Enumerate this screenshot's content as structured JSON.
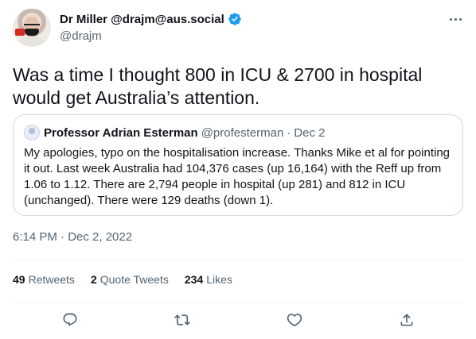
{
  "author": {
    "display_name": "Dr Miller @drajm@aus.social",
    "handle": "@drajm"
  },
  "tweet": {
    "text": "Was a time I thought 800 in ICU & 2700 in hospital would get Australia’s attention."
  },
  "quoted_tweet": {
    "name": "Professor Adrian Esterman",
    "handle": "@profesterman",
    "separator": "·",
    "date": "Dec 2",
    "text": "My apologies, typo on the hospitalisation increase. Thanks Mike et al for pointing it out. Last week Australia had 104,376 cases (up 16,164) with the Reff up from 1.06 to 1.12. There are 2,794 people in hospital (up 281) and 812 in ICU (unchanged). There were 129 deaths (down 1)."
  },
  "timestamp": "6:14 PM · Dec 2, 2022",
  "stats": {
    "retweets_count": "49",
    "retweets_label": "Retweets",
    "quotes_count": "2",
    "quotes_label": "Quote Tweets",
    "likes_count": "234",
    "likes_label": "Likes"
  },
  "icons": {
    "verified": "verified-badge-icon",
    "more": "more-options-icon",
    "reply": "reply-icon",
    "retweet": "retweet-icon",
    "like": "like-icon",
    "share": "share-icon"
  },
  "colors": {
    "verified": "#1d9bf0",
    "secondary_text": "#536471",
    "border": "#cfd9de",
    "divider": "#eff3f4"
  }
}
